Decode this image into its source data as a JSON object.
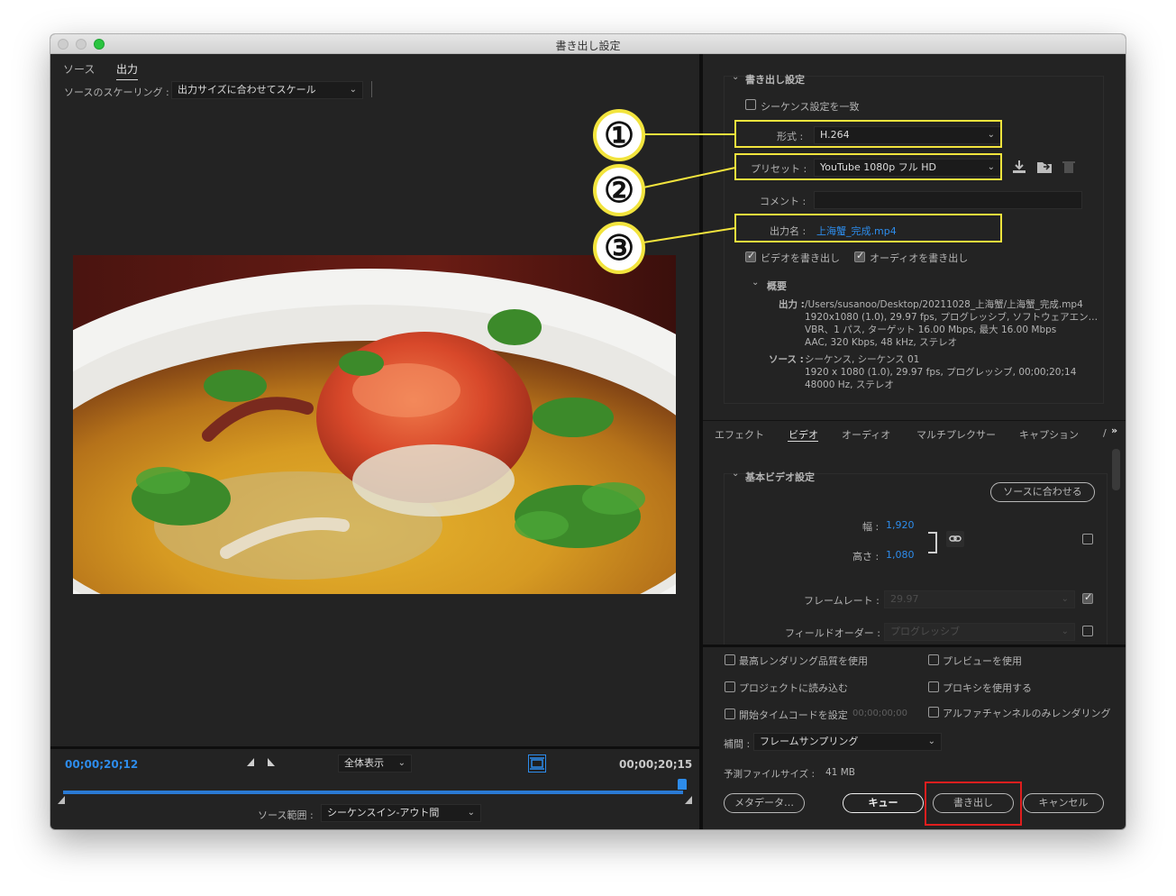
{
  "window": {
    "title": "書き出し設定"
  },
  "left": {
    "tabs": [
      {
        "label": "ソース"
      },
      {
        "label": "出力"
      }
    ],
    "scaling": {
      "label": "ソースのスケーリング :",
      "value": "出力サイズに合わせてスケール"
    },
    "timeline": {
      "current_time": "00;00;20;12",
      "end_time": "00;00;20;15",
      "zoom_value": "全体表示",
      "source_range_label": "ソース範囲 :",
      "source_range_value": "シーケンスイン-アウト間",
      "playhead_position_fraction": 1.0
    }
  },
  "export_settings": {
    "section_title": "書き出し設定",
    "match_sequence_label": "シーケンス設定を一致",
    "format": {
      "label": "形式 :",
      "value": "H.264"
    },
    "preset": {
      "label": "プリセット :",
      "value": "YouTube 1080p フル HD"
    },
    "comment": {
      "label": "コメント :",
      "value": ""
    },
    "output_name": {
      "label": "出力名 :",
      "value": "上海蟹_完成.mp4"
    },
    "export_video_label": "ビデオを書き出し",
    "export_audio_label": "オーディオを書き出し",
    "summary": {
      "title": "概要",
      "output_label": "出力 :",
      "output_lines": [
        "/Users/susanoo/Desktop/20211028_上海蟹/上海蟹_完成.mp4",
        "1920x1080 (1.0), 29.97 fps, プログレッシブ, ソフトウェアエン…",
        "VBR、1 パス, ターゲット 16.00 Mbps, 最大 16.00 Mbps",
        "AAC, 320 Kbps, 48 kHz, ステレオ"
      ],
      "source_label": "ソース :",
      "source_lines": [
        "シーケンス, シーケンス 01",
        "1920 x 1080 (1.0), 29.97 fps, プログレッシブ, 00;00;20;14",
        "48000 Hz, ステレオ"
      ]
    }
  },
  "annotations": {
    "markers": [
      "①",
      "②",
      "③"
    ]
  },
  "settings_tabs": [
    {
      "label": "エフェクト"
    },
    {
      "label": "ビデオ"
    },
    {
      "label": "オーディオ"
    },
    {
      "label": "マルチプレクサー"
    },
    {
      "label": "キャプション"
    },
    {
      "label": "/"
    }
  ],
  "video_settings": {
    "section_title": "基本ビデオ設定",
    "match_source_button": "ソースに合わせる",
    "width_label": "幅 :",
    "width_value": "1,920",
    "height_label": "高さ :",
    "height_value": "1,080",
    "frame_rate_label": "フレームレート :",
    "frame_rate_value": "29.97",
    "field_order_label": "フィールドオーダー :",
    "field_order_value": "プログレッシブ"
  },
  "bottom": {
    "options": [
      {
        "label": "最高レンダリング品質を使用"
      },
      {
        "label": "プレビューを使用"
      },
      {
        "label": "プロジェクトに読み込む"
      },
      {
        "label": "プロキシを使用する"
      },
      {
        "label": "開始タイムコードを設定"
      },
      {
        "label": "アルファチャンネルのみレンダリング"
      }
    ],
    "start_timecode_value": "00;00;00;00",
    "interpolation_label": "補間 :",
    "interpolation_value": "フレームサンプリング",
    "filesize_label": "予測ファイルサイズ :",
    "filesize_value": "41 MB",
    "buttons": {
      "metadata": "メタデータ…",
      "queue": "キュー",
      "export": "書き出し",
      "cancel": "キャンセル"
    }
  },
  "colors": {
    "accent_blue": "#2d8ceb",
    "highlight_yellow": "#f2e43d",
    "highlight_red": "#e01e1e",
    "panel_bg": "#232323"
  }
}
